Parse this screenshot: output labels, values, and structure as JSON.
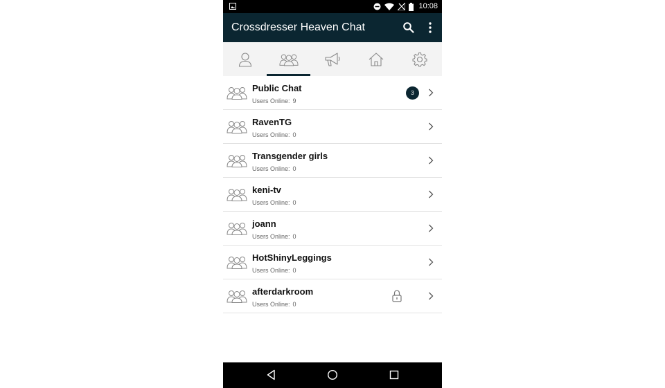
{
  "status_bar": {
    "time": "10:08"
  },
  "app_bar": {
    "title": "Crossdresser Heaven Chat",
    "icons": {
      "search": "search-icon",
      "menu": "more-vert-icon"
    }
  },
  "tabs": [
    {
      "icon": "person-icon",
      "active": false
    },
    {
      "icon": "group-icon",
      "active": true
    },
    {
      "icon": "megaphone-icon",
      "active": false
    },
    {
      "icon": "home-icon",
      "active": false
    },
    {
      "icon": "gear-icon",
      "active": false
    }
  ],
  "rooms": [
    {
      "name": "Public Chat",
      "online_label": "Users Online:",
      "online_count": "9",
      "badge": "3"
    },
    {
      "name": "RavenTG",
      "online_label": "Users Online:",
      "online_count": "0"
    },
    {
      "name": "Transgender girls",
      "online_label": "Users Online:",
      "online_count": "0"
    },
    {
      "name": "keni-tv",
      "online_label": "Users Online:",
      "online_count": "0"
    },
    {
      "name": "joann",
      "online_label": "Users Online:",
      "online_count": "0"
    },
    {
      "name": "HotShinyLeggings",
      "online_label": "Users Online:",
      "online_count": "0"
    },
    {
      "name": "afterdarkroom",
      "online_label": "Users Online:",
      "online_count": "0",
      "locked": true
    }
  ],
  "colors": {
    "app_bar": "#0b2631",
    "accent": "#0b2631",
    "tab_bar": "#f3f3f3"
  }
}
